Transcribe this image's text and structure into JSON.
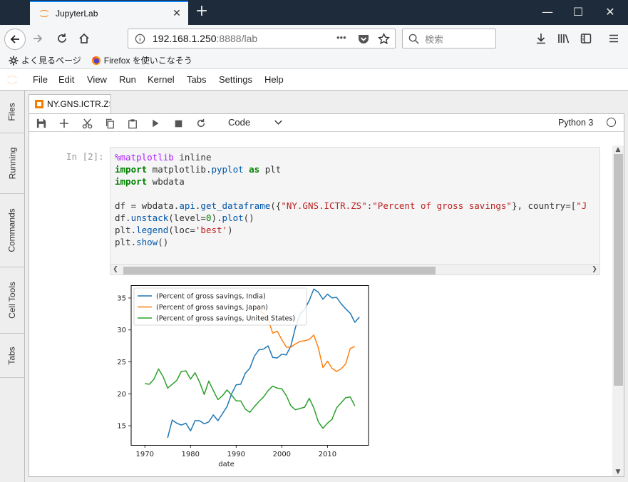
{
  "browser": {
    "tab_title": "JupyterLab",
    "new_tab_symbol": "+",
    "url_host": "192.168.1.250",
    "url_rest": ":8888/lab",
    "url_dots": "•••",
    "search_placeholder": "検索",
    "bookmarks": [
      {
        "label": "よく見るページ"
      },
      {
        "label": "Firefox を使いこなそう"
      }
    ]
  },
  "jupyter": {
    "menu": [
      "File",
      "Edit",
      "View",
      "Run",
      "Kernel",
      "Tabs",
      "Settings",
      "Help"
    ],
    "sidebar_tabs": [
      "Files",
      "Running",
      "Commands",
      "Cell Tools",
      "Tabs"
    ],
    "doc_tab": "NY.GNS.ICTR.ZS",
    "cell_type": "Code",
    "kernel": "Python 3",
    "cell": {
      "prompt": "In [2]:",
      "lines": [
        "%matplotlib inline",
        "import matplotlib.pyplot as plt",
        "import wbdata",
        "",
        "df = wbdata.api.get_dataframe({\"NY.GNS.ICTR.ZS\":\"Percent of gross savings\"}, country=[\"J",
        "df.unstack(level=0).plot()",
        "plt.legend(loc='best')",
        "plt.show()"
      ]
    }
  },
  "colors": {
    "india": "#1f77b4",
    "japan": "#ff7f0e",
    "us": "#2ca02c",
    "jupyter_orange": "#f57c00"
  },
  "chart_data": {
    "type": "line",
    "xlabel": "date",
    "ylabel": "",
    "title": "",
    "xlim": [
      1967,
      2019
    ],
    "ylim": [
      12.0,
      37.0
    ],
    "xticks": [
      1970,
      1980,
      1990,
      2000,
      2010
    ],
    "yticks": [
      15,
      20,
      25,
      30,
      35
    ],
    "legend_position": "top-left",
    "series": [
      {
        "name": "(Percent of gross savings, India)",
        "color": "#1f77b4",
        "x": [
          1975,
          1976,
          1977,
          1978,
          1979,
          1980,
          1981,
          1982,
          1983,
          1984,
          1985,
          1986,
          1987,
          1988,
          1989,
          1990,
          1991,
          1992,
          1993,
          1994,
          1995,
          1996,
          1997,
          1998,
          1999,
          2000,
          2001,
          2002,
          2003,
          2004,
          2005,
          2006,
          2007,
          2008,
          2009,
          2010,
          2011,
          2012,
          2013,
          2014,
          2015,
          2016,
          2017
        ],
        "y": [
          13.1,
          15.9,
          15.4,
          15.1,
          15.4,
          14.2,
          15.8,
          15.8,
          15.3,
          15.6,
          16.7,
          15.8,
          16.9,
          18.0,
          20.0,
          21.4,
          21.5,
          23.2,
          24.0,
          25.9,
          26.9,
          27.0,
          27.5,
          25.7,
          25.6,
          26.2,
          26.1,
          27.5,
          30.4,
          32.5,
          33.2,
          34.6,
          36.4,
          35.9,
          34.8,
          35.6,
          35.0,
          35.1,
          34.1,
          33.3,
          32.6,
          31.2,
          32.0
        ]
      },
      {
        "name": "(Percent of gross savings, Japan)",
        "color": "#ff7f0e",
        "x": [
          1994,
          1995,
          1996,
          1997,
          1998,
          1999,
          2000,
          2001,
          2002,
          2003,
          2004,
          2005,
          2006,
          2007,
          2008,
          2009,
          2010,
          2011,
          2012,
          2013,
          2014,
          2015,
          2016
        ],
        "y": [
          33.5,
          33.1,
          32.6,
          31.7,
          29.5,
          29.8,
          28.5,
          27.3,
          27.3,
          27.8,
          28.2,
          28.3,
          28.5,
          29.2,
          27.2,
          24.1,
          25.1,
          24.0,
          23.5,
          23.9,
          24.7,
          27.1,
          27.4
        ]
      },
      {
        "name": "(Percent of gross savings, United States)",
        "color": "#2ca02c",
        "x": [
          1970,
          1971,
          1972,
          1973,
          1974,
          1975,
          1976,
          1977,
          1978,
          1979,
          1980,
          1981,
          1982,
          1983,
          1984,
          1985,
          1986,
          1987,
          1988,
          1989,
          1990,
          1991,
          1992,
          1993,
          1994,
          1995,
          1996,
          1997,
          1998,
          1999,
          2000,
          2001,
          2002,
          2003,
          2004,
          2005,
          2006,
          2007,
          2008,
          2009,
          2010,
          2011,
          2012,
          2013,
          2014,
          2015,
          2016
        ],
        "y": [
          21.6,
          21.5,
          22.3,
          23.9,
          22.7,
          20.9,
          21.5,
          22.1,
          23.5,
          23.6,
          22.3,
          23.3,
          21.8,
          19.9,
          22.0,
          20.5,
          19.1,
          19.7,
          20.6,
          19.8,
          18.9,
          18.9,
          17.6,
          17.1,
          18.0,
          18.8,
          19.5,
          20.5,
          21.2,
          20.9,
          20.8,
          19.7,
          18.1,
          17.5,
          17.7,
          17.9,
          19.3,
          17.8,
          15.6,
          14.6,
          15.4,
          16.0,
          17.8,
          18.6,
          19.4,
          19.5,
          18.1
        ]
      }
    ]
  }
}
